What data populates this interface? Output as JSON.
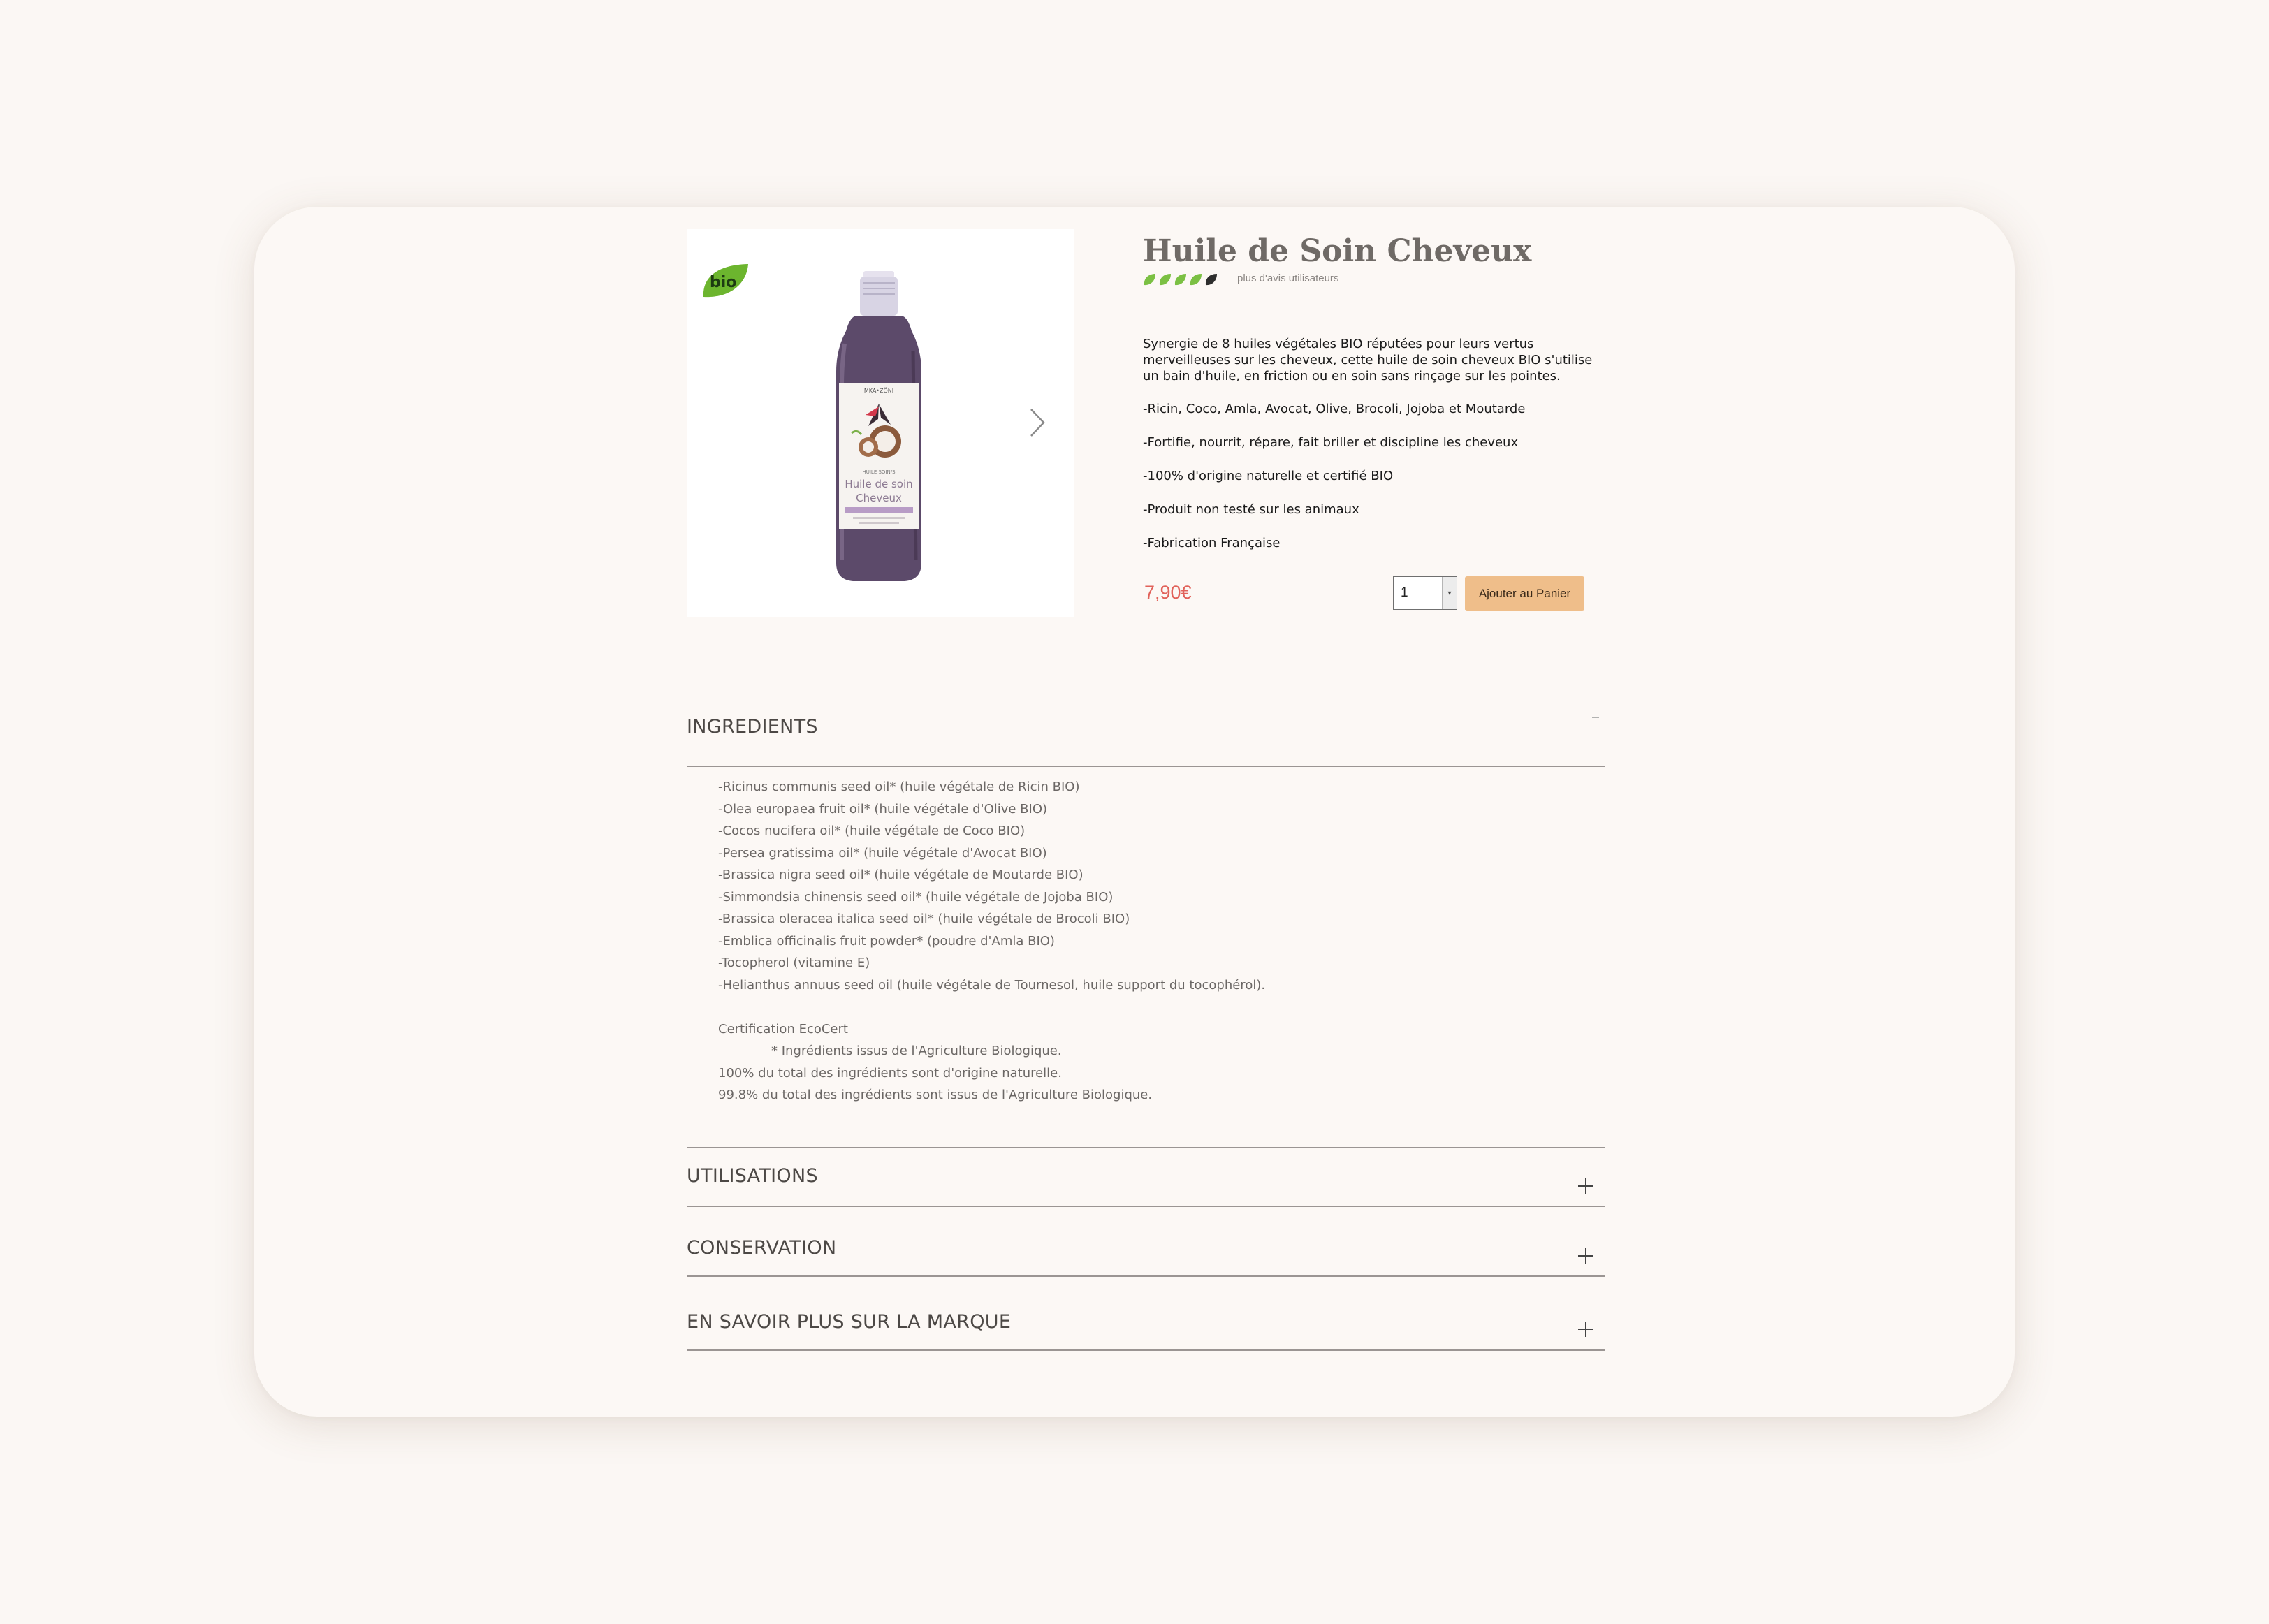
{
  "product": {
    "name": "Huile de Soin Cheveux",
    "rating_note": "plus d'avis utilisateurs",
    "badge": "bio",
    "bottle_label": {
      "brand": "MKA•ZÖNI",
      "range": "HUILE SOIN/S",
      "name_line1": "Huile de soin",
      "name_line2": "Cheveux"
    },
    "description": "Synergie de 8 huiles végétales BIO réputées pour leurs vertus merveilleuses sur les cheveux, cette huile de soin cheveux BIO s'utilise un bain d'huile, en friction ou en soin sans rinçage sur les pointes.",
    "features": [
      "-Ricin, Coco, Amla, Avocat, Olive, Brocoli, Jojoba et Moutarde",
      "-Fortifie, nourrit, répare, fait briller et discipline les cheveux",
      "-100% d'origine naturelle et certifié BIO",
      "-Produit non testé sur les animaux",
      "-Fabrication Française"
    ],
    "price": "7,90€",
    "quantity": "1",
    "add_to_cart_label": "Ajouter au Panier"
  },
  "sections": {
    "ingredients": {
      "title": "INGREDIENTS",
      "items": [
        "-Ricinus communis seed oil* (huile végétale de Ricin BIO)",
        "-Olea europaea fruit oil* (huile végétale d'Olive BIO)",
        "-Cocos nucifera oil* (huile végétale de Coco BIO)",
        "-Persea gratissima oil* (huile végétale d'Avocat BIO)",
        "-Brassica nigra seed oil* (huile végétale de Moutarde BIO)",
        "-Simmondsia chinensis seed oil* (huile végétale de Jojoba BIO)",
        "-Brassica oleracea italica seed oil* (huile végétale de Brocoli BIO)",
        "-Emblica officinalis fruit powder* (poudre d'Amla BIO)",
        "-Tocopherol (vitamine E)",
        "-Helianthus annuus seed oil (huile végétale de Tournesol, huile support du tocophérol)."
      ],
      "certification": "Certification EcoCert",
      "note": "* Ingrédients issus de l'Agriculture Biologique.",
      "natural_origin": "100% du total des ingrédients sont d'origine naturelle.",
      "organic_origin": "99.8% du total des ingrédients sont issus de l'Agriculture Biologique."
    },
    "utilisations": {
      "title": "UTILISATIONS"
    },
    "conservation": {
      "title": "CONSERVATION"
    },
    "brand": {
      "title": "EN SAVOIR PLUS SUR LA MARQUE"
    }
  },
  "icons": {
    "bio_badge": "leaf-badge-icon",
    "next": "chevron-right-icon",
    "rating_leaf": "leaf-icon",
    "expand": "plus-icon",
    "collapse": "minus-icon",
    "stepper": "caret-down-icon"
  },
  "colors": {
    "page_background": "#fbf7f4",
    "price": "#e1625a",
    "button": "#efbe8a",
    "leaf_green": "#7bc043",
    "badge_green": "#6cb52e"
  }
}
